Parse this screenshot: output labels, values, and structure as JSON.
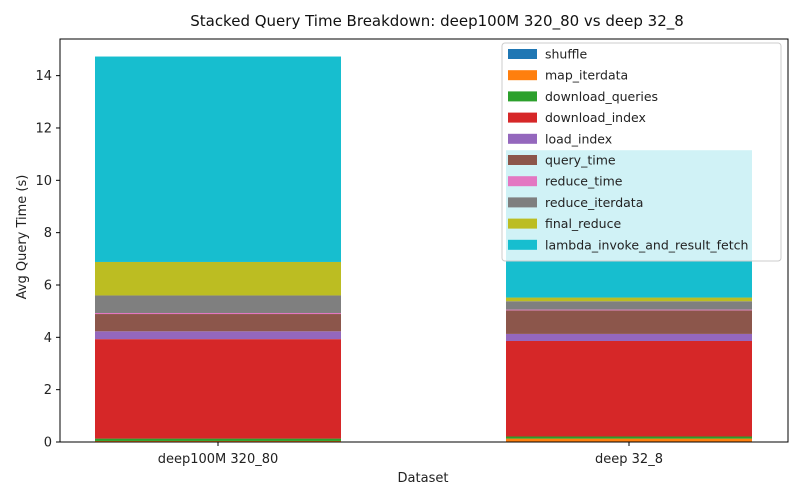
{
  "chart_data": {
    "type": "bar",
    "stacked": true,
    "title": "Stacked Query Time Breakdown: deep100M 320_80 vs deep 32_8",
    "xlabel": "Dataset",
    "ylabel": "Avg Query Time (s)",
    "ylim": [
      0,
      15.4
    ],
    "yticks": [
      "0",
      "2",
      "4",
      "6",
      "8",
      "10",
      "12",
      "14"
    ],
    "categories": [
      "deep100M 320_80",
      "deep 32_8"
    ],
    "legend_position": "top-right",
    "grid": false,
    "series": [
      {
        "name": "shuffle",
        "color": "#1f77b4",
        "values": [
          0.01,
          0.01
        ]
      },
      {
        "name": "map_iterdata",
        "color": "#ff7f0e",
        "values": [
          0.03,
          0.12
        ]
      },
      {
        "name": "download_queries",
        "color": "#2ca02c",
        "values": [
          0.09,
          0.08
        ]
      },
      {
        "name": "download_index",
        "color": "#d62728",
        "values": [
          3.8,
          3.65
        ]
      },
      {
        "name": "load_index",
        "color": "#9467bd",
        "values": [
          0.3,
          0.27
        ]
      },
      {
        "name": "query_time",
        "color": "#8c564b",
        "values": [
          0.66,
          0.9
        ]
      },
      {
        "name": "reduce_time",
        "color": "#e377c2",
        "values": [
          0.04,
          0.03
        ]
      },
      {
        "name": "reduce_iterdata",
        "color": "#7f7f7f",
        "values": [
          0.67,
          0.32
        ]
      },
      {
        "name": "final_reduce",
        "color": "#bcbd22",
        "values": [
          1.28,
          0.14
        ]
      },
      {
        "name": "lambda_invoke_and_result_fetch",
        "color": "#17becf",
        "values": [
          7.85,
          5.63
        ]
      }
    ]
  }
}
